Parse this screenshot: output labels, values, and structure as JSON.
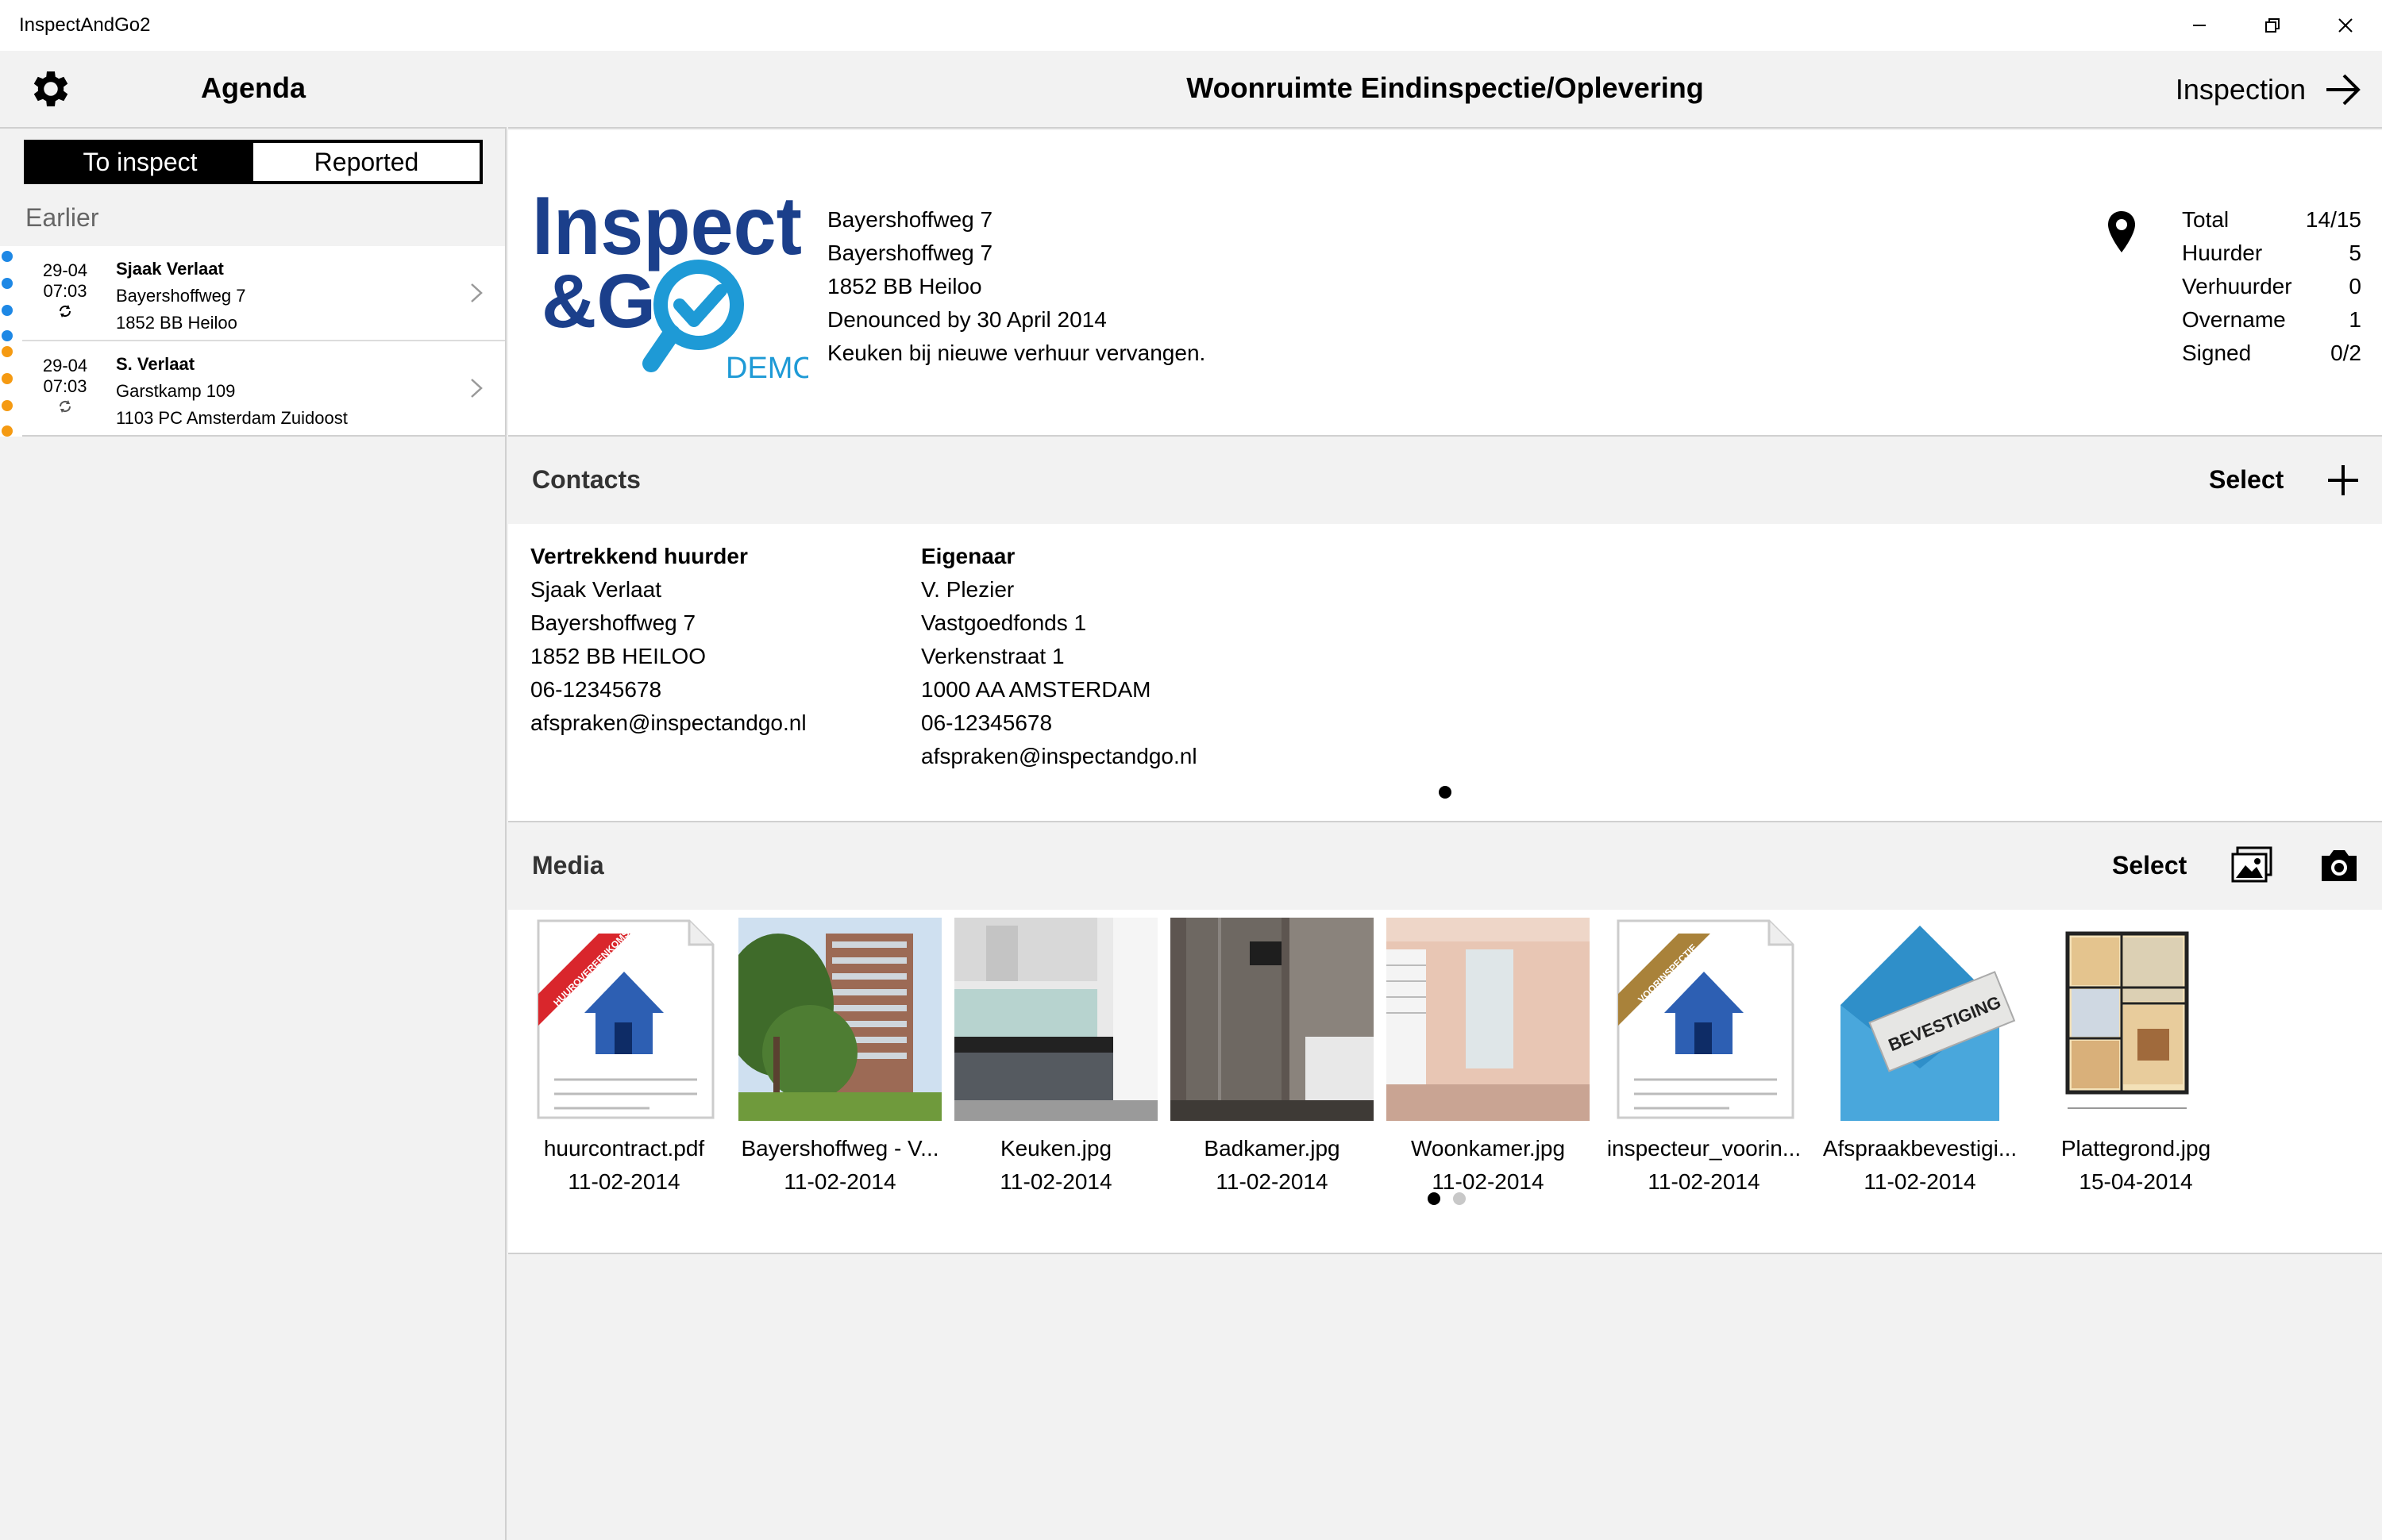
{
  "window": {
    "title": "InspectAndGo2"
  },
  "sidebar": {
    "title": "Agenda",
    "tabs": [
      {
        "label": "To inspect",
        "active": true
      },
      {
        "label": "Reported",
        "active": false
      }
    ],
    "group_label": "Earlier",
    "items": [
      {
        "date": "29-04",
        "time": "07:03",
        "name": "Sjaak Verlaat",
        "line1": "Bayershoffweg 7",
        "line2": "1852 BB Heiloo",
        "dot_color": "#1e88e5"
      },
      {
        "date": "29-04",
        "time": "07:03",
        "name": "S. Verlaat",
        "line1": "Garstkamp 109",
        "line2": "1103 PC Amsterdam Zuidoost",
        "dot_color": "#f59a12"
      }
    ]
  },
  "header": {
    "title": "Woonruimte Eindinspectie/Oplevering",
    "action_label": "Inspection"
  },
  "info": {
    "logo": {
      "line1": "Inspect",
      "line2": "&G",
      "badge": "DEMO"
    },
    "address_lines": [
      "Bayershoffweg 7",
      "Bayershoffweg 7",
      "1852 BB Heiloo",
      "Denounced by 30 April 2014",
      "Keuken bij nieuwe verhuur vervangen."
    ],
    "stats": [
      {
        "label": "Total",
        "value": "14/15"
      },
      {
        "label": "Huurder",
        "value": "5"
      },
      {
        "label": "Verhuurder",
        "value": "0"
      },
      {
        "label": "Overname",
        "value": "1"
      },
      {
        "label": "Signed",
        "value": "0/2"
      }
    ]
  },
  "contacts": {
    "title": "Contacts",
    "select_label": "Select",
    "people": [
      {
        "role": "Vertrekkend huurder",
        "lines": [
          "Sjaak Verlaat",
          "Bayershoffweg 7",
          "1852 BB HEILOO",
          "06-12345678",
          "afspraken@inspectandgo.nl"
        ]
      },
      {
        "role": "Eigenaar",
        "lines": [
          "V. Plezier",
          "Vastgoedfonds 1",
          "Verkenstraat 1",
          "1000 AA AMSTERDAM",
          "06-12345678",
          "afspraken@inspectandgo.nl"
        ]
      }
    ]
  },
  "media": {
    "title": "Media",
    "select_label": "Select",
    "items": [
      {
        "name": "huurcontract.pdf",
        "date": "11-02-2014",
        "kind": "doc",
        "ribbon": "HUUROVEREENKOMST",
        "ribbon_color": "#d9262c"
      },
      {
        "name": "Bayershoffweg - V...",
        "date": "11-02-2014",
        "kind": "building"
      },
      {
        "name": "Keuken.jpg",
        "date": "11-02-2014",
        "kind": "kitchen"
      },
      {
        "name": "Badkamer.jpg",
        "date": "11-02-2014",
        "kind": "bathroom"
      },
      {
        "name": "Woonkamer.jpg",
        "date": "11-02-2014",
        "kind": "livingroom"
      },
      {
        "name": "inspecteur_voorin...",
        "date": "11-02-2014",
        "kind": "doc",
        "ribbon": "VOORINSPECTIE",
        "ribbon_color": "#a9823a"
      },
      {
        "name": "Afspraakbevestigi...",
        "date": "11-02-2014",
        "kind": "envelope",
        "card_text": "BEVESTIGING"
      },
      {
        "name": "Plattegrond.jpg",
        "date": "15-04-2014",
        "kind": "floorplan"
      }
    ]
  },
  "colors": {
    "accent_blue": "#1e88e5",
    "accent_orange": "#f59a12",
    "logo_navy": "#1b3f8b",
    "logo_cyan": "#1e9ad6"
  }
}
